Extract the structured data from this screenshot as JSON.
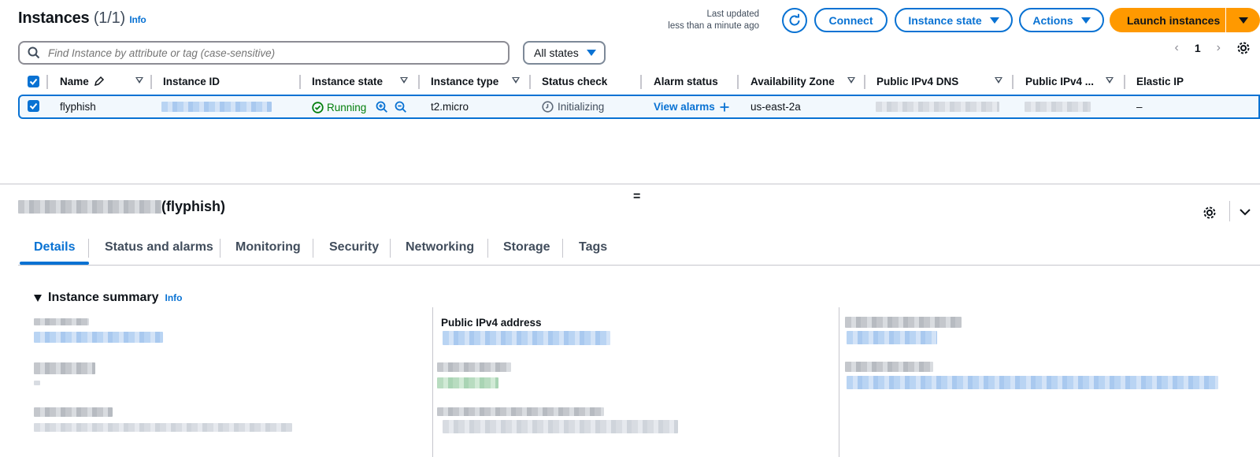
{
  "header": {
    "title": "Instances",
    "count": "(1/1)",
    "info": "Info",
    "last_updated_label": "Last updated",
    "last_updated_value": "less than a minute ago",
    "connect": "Connect",
    "instance_state": "Instance state",
    "actions": "Actions",
    "launch": "Launch instances"
  },
  "filters": {
    "search_placeholder": "Find Instance by attribute or tag (case-sensitive)",
    "states": "All states",
    "page": "1"
  },
  "table": {
    "columns": {
      "name": "Name",
      "instance_id": "Instance ID",
      "instance_state": "Instance state",
      "instance_type": "Instance type",
      "status_check": "Status check",
      "alarm_status": "Alarm status",
      "availability_zone": "Availability Zone",
      "public_dns": "Public IPv4 DNS",
      "public_ip": "Public IPv4 ...",
      "elastic_ip": "Elastic IP"
    },
    "rows": [
      {
        "name": "flyphish",
        "state": "Running",
        "type": "t2.micro",
        "status": "Initializing",
        "alarms": "View alarms",
        "az": "us-east-2a",
        "elastic_ip": "–"
      }
    ]
  },
  "details": {
    "title_suffix": "(flyphish)",
    "tabs": [
      "Details",
      "Status and alarms",
      "Monitoring",
      "Security",
      "Networking",
      "Storage",
      "Tags"
    ],
    "summary_title": "Instance summary",
    "summary_info": "Info",
    "public_ipv4_label": "Public IPv4 address"
  },
  "colors": {
    "accent": "#0972d3",
    "launch": "#ff9900",
    "running": "#037f0c",
    "row_selected": "#f2f8fd"
  }
}
